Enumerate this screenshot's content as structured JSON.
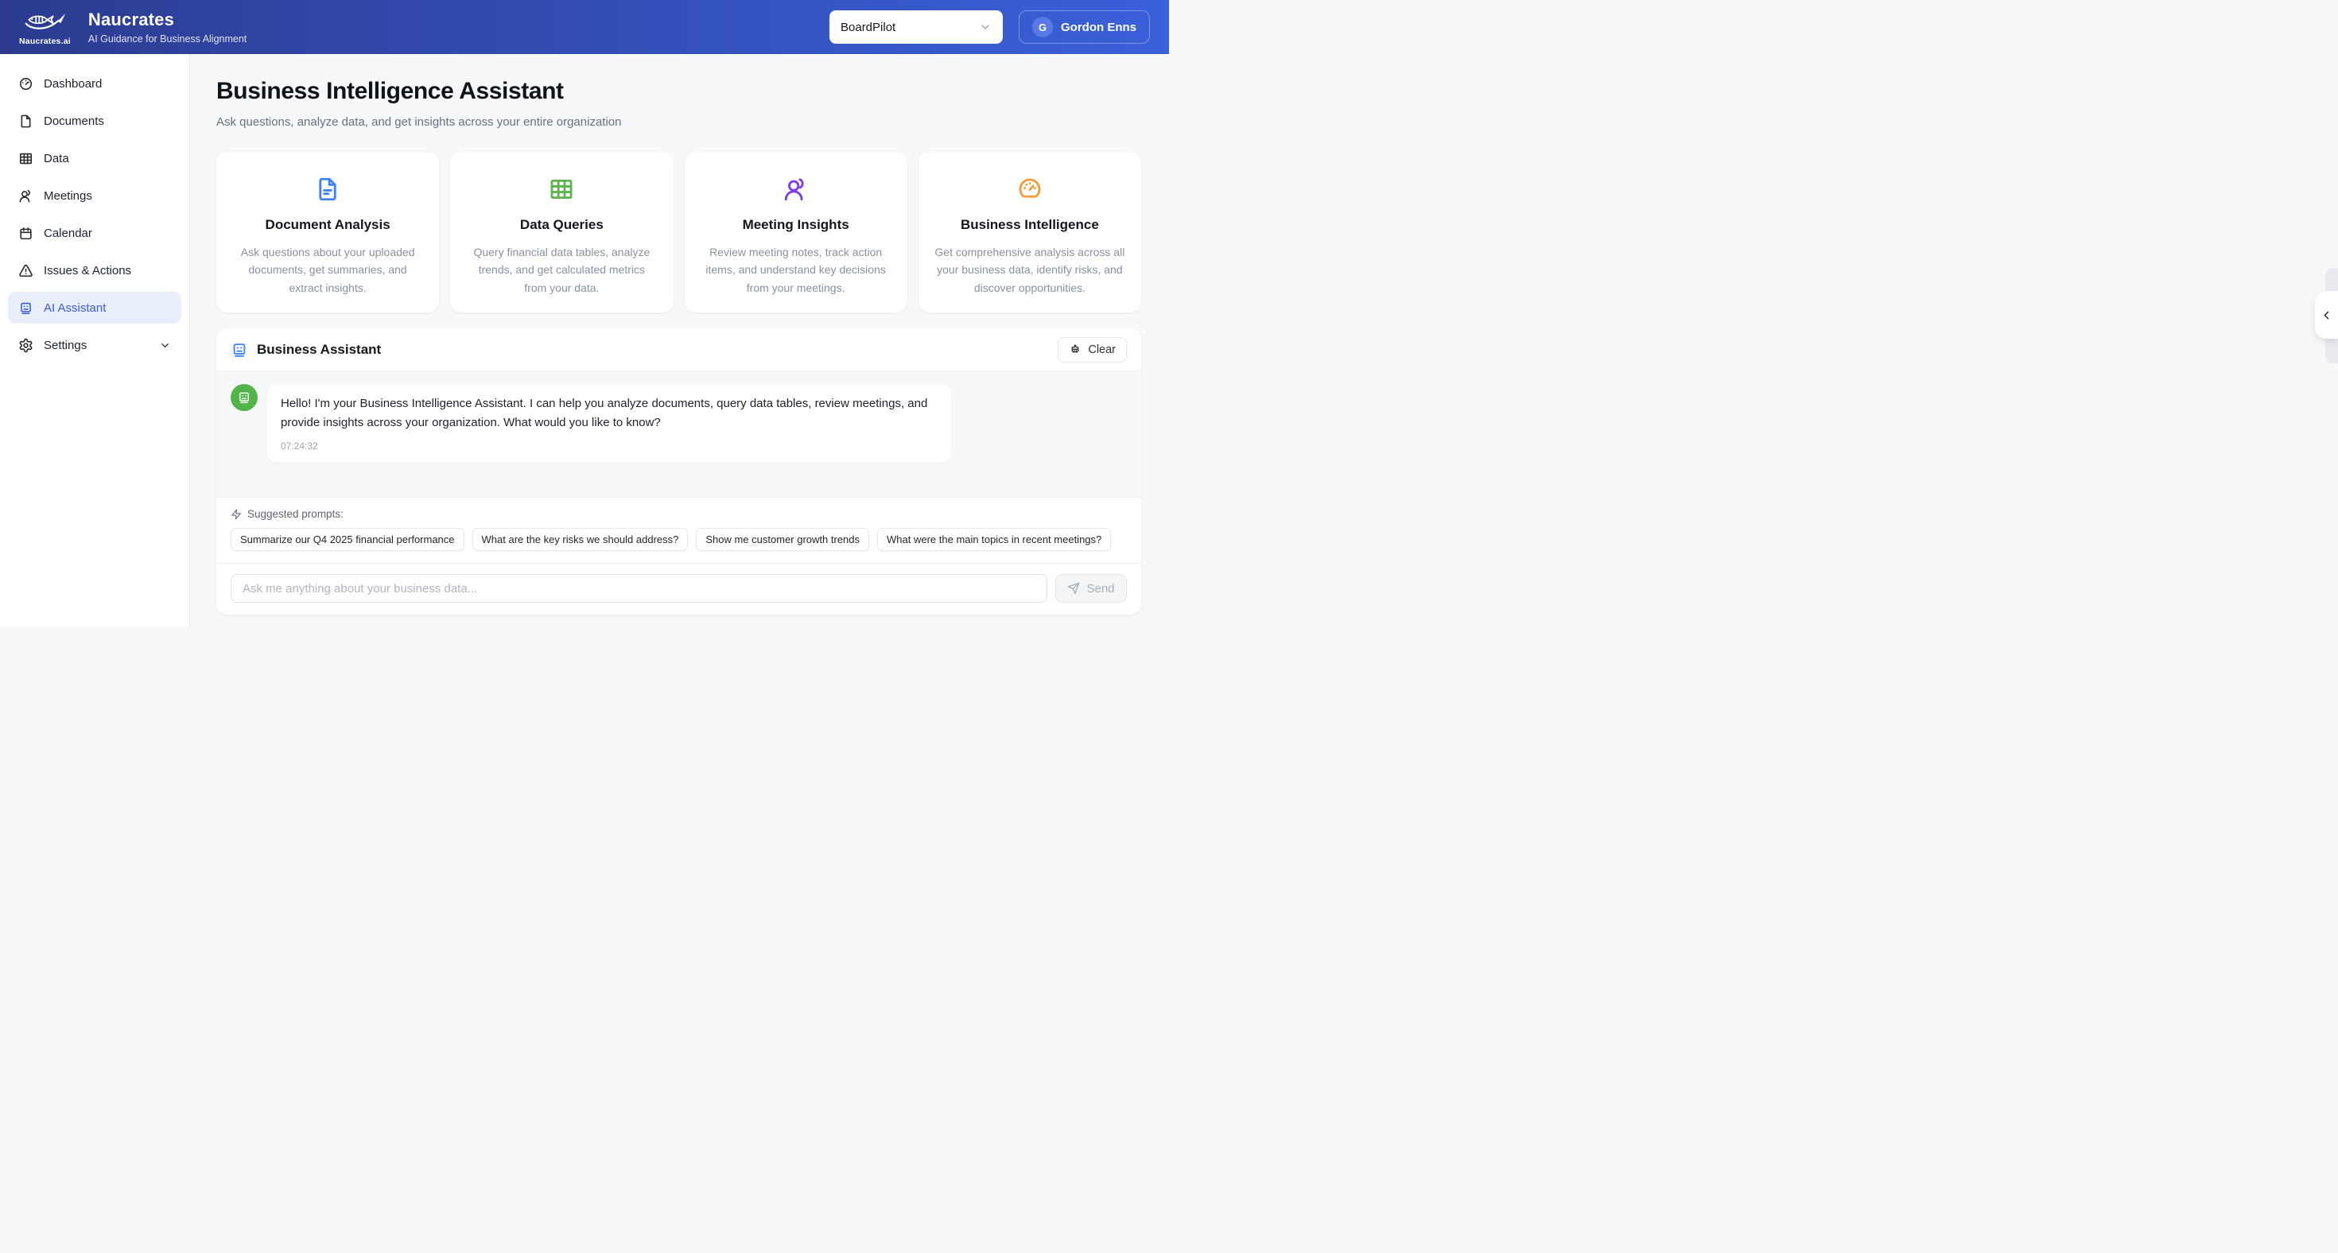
{
  "header": {
    "app_name": "Naucrates",
    "tagline": "AI Guidance for Business Alignment",
    "logo_caption": "Naucrates.ai",
    "workspace_select_value": "BoardPilot",
    "user": {
      "initial": "G",
      "name": "Gordon Enns"
    }
  },
  "sidebar": {
    "items": [
      {
        "label": "Dashboard"
      },
      {
        "label": "Documents"
      },
      {
        "label": "Data"
      },
      {
        "label": "Meetings"
      },
      {
        "label": "Calendar"
      },
      {
        "label": "Issues & Actions"
      },
      {
        "label": "AI Assistant"
      },
      {
        "label": "Settings"
      }
    ]
  },
  "main": {
    "title": "Business Intelligence Assistant",
    "subtitle": "Ask questions, analyze data, and get insights across your entire organization",
    "cards": [
      {
        "title": "Document Analysis",
        "description": "Ask questions about your uploaded documents, get summaries, and extract insights.",
        "icon": "file-text-icon",
        "color": "#3b82f6"
      },
      {
        "title": "Data Queries",
        "description": "Query financial data tables, analyze trends, and get calculated metrics from your data.",
        "icon": "table-icon",
        "color": "#5cb44e"
      },
      {
        "title": "Meeting Insights",
        "description": "Review meeting notes, track action items, and understand key decisions from your meetings.",
        "icon": "users-icon",
        "color": "#7c3aed"
      },
      {
        "title": "Business Intelligence",
        "description": "Get comprehensive analysis across all your business data, identify risks, and discover opportunities.",
        "icon": "gauge-icon",
        "color": "#f09d3c"
      }
    ],
    "chat": {
      "panel_title": "Business Assistant",
      "panel_icon_color": "#3b82f6",
      "clear_label": "Clear",
      "message": {
        "text": "Hello! I'm your Business Intelligence Assistant. I can help you analyze documents, query data tables, review meetings, and provide insights across your organization. What would you like to know?",
        "time": "07:24:32",
        "avatar_color": "#52b54a"
      },
      "suggested_label": "Suggested prompts:",
      "prompts": [
        {
          "label": "Summarize our Q4 2025 financial performance"
        },
        {
          "label": "What are the key risks we should address?"
        },
        {
          "label": "Show me customer growth trends"
        },
        {
          "label": "What were the main topics in recent meetings?"
        }
      ],
      "input_placeholder": "Ask me anything about your business data...",
      "send_label": "Send"
    }
  },
  "colors": {
    "header_gradient_left": "#2c3b90",
    "header_gradient_right": "#3a60da",
    "sidebar_active_text": "#3b5bd7",
    "sidebar_active_bg": "#e9eefb",
    "page_background": "#f7f8fa"
  }
}
